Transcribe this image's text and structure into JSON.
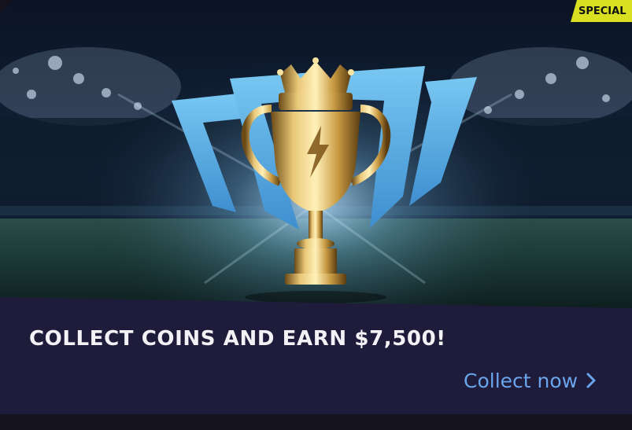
{
  "promo_card": {
    "badge": "SPECIAL",
    "headline": "COLLECT COINS AND EARN $7,500!",
    "cta_label": "Collect now",
    "cta_icon": "chevron-right-icon",
    "hero_image": "trophy-stadium-illustration",
    "colors": {
      "badge_background": "#d9e021",
      "panel_background": "#1e1c3a",
      "headline_text": "#f2f2f6",
      "cta_text": "#6aa4ec",
      "shield_blue": "#5fb6ec",
      "trophy_gold": "#c9a24a"
    }
  }
}
